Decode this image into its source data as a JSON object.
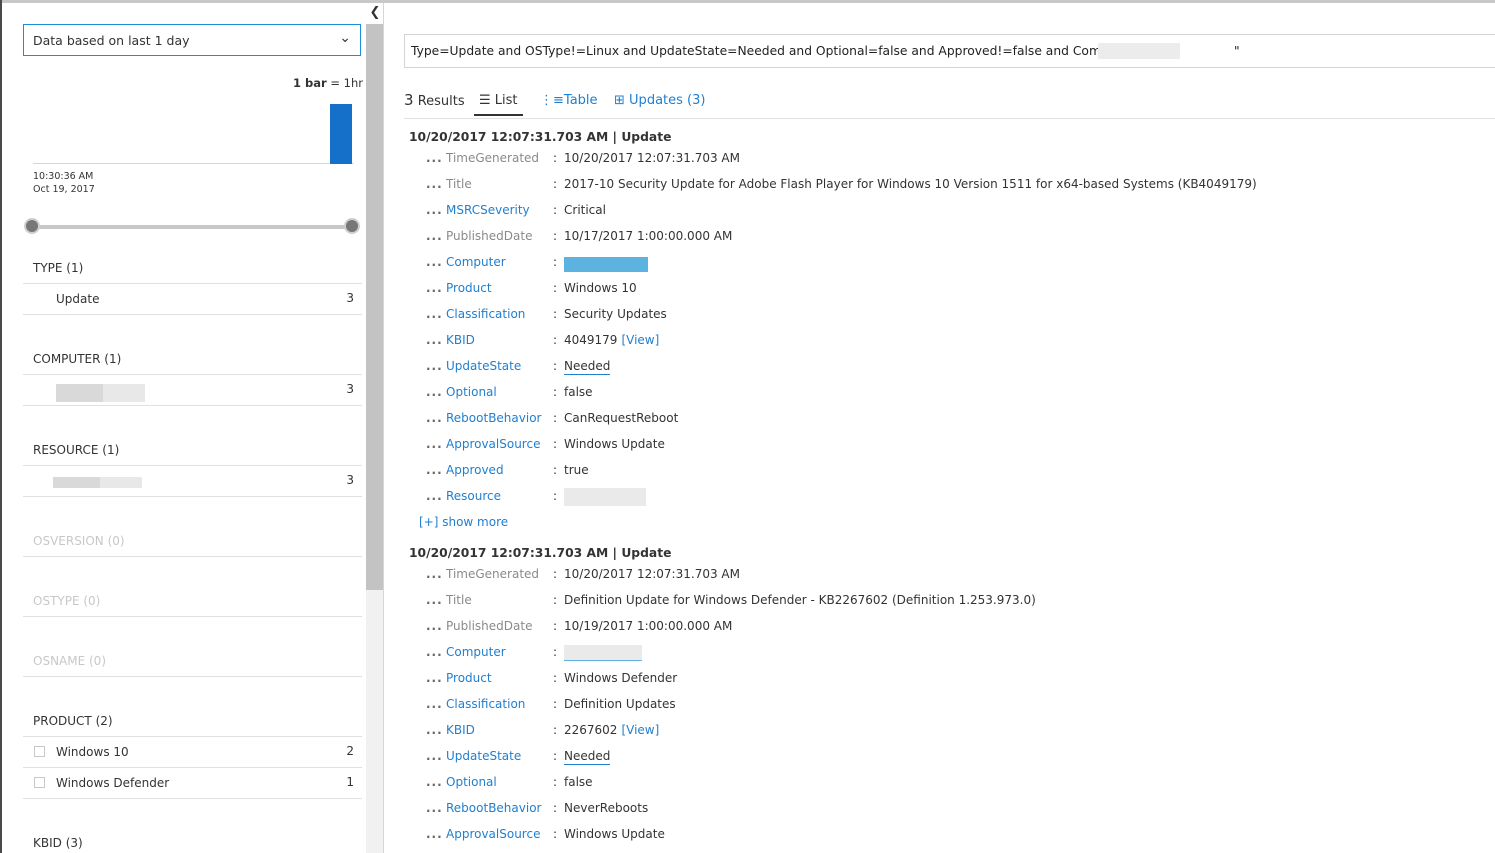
{
  "filter_panel": {
    "range_label": "Data based on last 1 day",
    "bar_legend_bold": "1 bar",
    "bar_legend_rest": " = 1hr",
    "hist_time": "10:30:36 AM",
    "hist_date": "Oct 19, 2017",
    "histogram": {
      "bucket_fraction": 1.0
    },
    "facets": {
      "type": {
        "title": "TYPE  (1)",
        "rows": [
          {
            "label": "Update",
            "count": "3"
          }
        ]
      },
      "computer": {
        "title": "COMPUTER  (1)",
        "rows": [
          {
            "count": "3"
          }
        ]
      },
      "resource": {
        "title": "RESOURCE  (1)",
        "rows": [
          {
            "count": "3"
          }
        ]
      },
      "osversion": {
        "title": "OSVERSION  (0)"
      },
      "ostype": {
        "title": "OSTYPE  (0)"
      },
      "osname": {
        "title": "OSNAME  (0)"
      },
      "product": {
        "title": "PRODUCT  (2)",
        "rows": [
          {
            "label": "Windows 10",
            "count": "2"
          },
          {
            "label": "Windows Defender",
            "count": "1"
          }
        ]
      },
      "kbid": {
        "title": "KBID  (3)"
      }
    }
  },
  "query": {
    "text_before": "Type=Update and OSType!=Linux and UpdateState=Needed and Optional=false and Approved!=false and Computer=\"",
    "text_after": "\""
  },
  "results": {
    "count": "3",
    "count_label": "Results",
    "tabs": {
      "list": "List",
      "table": "Table",
      "updates": "Updates (3)"
    }
  },
  "records": [
    {
      "header": "10/20/2017 12:07:31.703 AM | Update",
      "fields": {
        "TimeGenerated": {
          "label": "TimeGenerated",
          "value": "10/20/2017 12:07:31.703 AM"
        },
        "Title": {
          "label": "Title",
          "value": "2017-10 Security Update for Adobe Flash Player for Windows 10 Version 1511 for x64-based Systems (KB4049179)"
        },
        "MSRCSeverity": {
          "label": "MSRCSeverity",
          "value": "Critical"
        },
        "PublishedDate": {
          "label": "PublishedDate",
          "value": "10/17/2017 1:00:00.000 AM"
        },
        "Computer": {
          "label": "Computer"
        },
        "Product": {
          "label": "Product",
          "value": "Windows 10"
        },
        "Classification": {
          "label": "Classification",
          "value": "Security Updates"
        },
        "KBID": {
          "label": "KBID",
          "value": "4049179",
          "view": "[View]"
        },
        "UpdateState": {
          "label": "UpdateState",
          "value": "Needed"
        },
        "Optional": {
          "label": "Optional",
          "value": "false"
        },
        "RebootBehavior": {
          "label": "RebootBehavior",
          "value": "CanRequestReboot"
        },
        "ApprovalSource": {
          "label": "ApprovalSource",
          "value": "Windows Update"
        },
        "Approved": {
          "label": "Approved",
          "value": "true"
        },
        "Resource": {
          "label": "Resource"
        }
      },
      "show_more": "[+] show more"
    },
    {
      "header": "10/20/2017 12:07:31.703 AM | Update",
      "fields": {
        "TimeGenerated": {
          "label": "TimeGenerated",
          "value": "10/20/2017 12:07:31.703 AM"
        },
        "Title": {
          "label": "Title",
          "value": "Definition Update for Windows Defender - KB2267602 (Definition 1.253.973.0)"
        },
        "PublishedDate": {
          "label": "PublishedDate",
          "value": "10/19/2017 1:00:00.000 AM"
        },
        "Computer": {
          "label": "Computer"
        },
        "Product": {
          "label": "Product",
          "value": "Windows Defender"
        },
        "Classification": {
          "label": "Classification",
          "value": "Definition Updates"
        },
        "KBID": {
          "label": "KBID",
          "value": "2267602",
          "view": "[View]"
        },
        "UpdateState": {
          "label": "UpdateState",
          "value": "Needed"
        },
        "Optional": {
          "label": "Optional",
          "value": "false"
        },
        "RebootBehavior": {
          "label": "RebootBehavior",
          "value": "NeverReboots"
        },
        "ApprovalSource": {
          "label": "ApprovalSource",
          "value": "Windows Update"
        }
      }
    }
  ],
  "icons": {
    "collapse": "chevron-left-icon",
    "dropdown": "chevron-down-icon",
    "list": "list-icon",
    "table": "table-icon",
    "updates": "grid-icon",
    "row_menu": "ellipsis-icon"
  },
  "colors": {
    "accent": "#1f7fd0",
    "histogram_bar": "#1470c8",
    "text": "#333333",
    "muted": "#8a8a8a"
  }
}
